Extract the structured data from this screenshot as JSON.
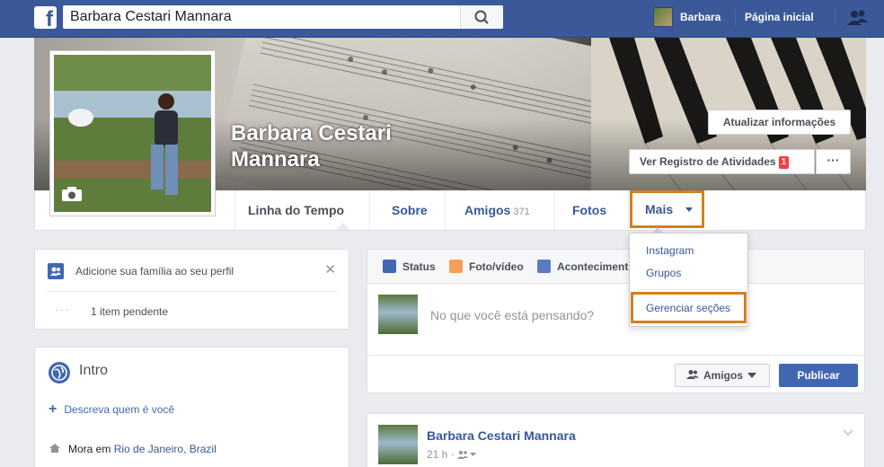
{
  "topbar": {
    "logo": "f",
    "search_value": "Barbara Cestari Mannara",
    "user_name": "Barbara",
    "home_label": "Página inicial"
  },
  "profile": {
    "name": "Barbara Cestari Mannara",
    "update_info": "Atualizar informações",
    "activity_log": "Ver Registro de Atividades",
    "activity_badge": "1",
    "more": "···"
  },
  "tabs": {
    "timeline": "Linha do Tempo",
    "about": "Sobre",
    "friends": "Amigos",
    "friends_count": "371",
    "photos": "Fotos",
    "more": "Mais"
  },
  "dropdown": {
    "items": [
      "Instagram",
      "Grupos"
    ],
    "manage": "Gerenciar seções"
  },
  "family": {
    "text": "Adicione sua família ao seu perfil",
    "close": "✕",
    "dots": "···",
    "pending": "1 item pendente"
  },
  "intro": {
    "title": "Intro",
    "add": "Descreva quem é você",
    "lives_prefix": "Mora em ",
    "lives_city": "Rio de Janeiro, Brazil"
  },
  "composer": {
    "tab_status": "Status",
    "tab_photo": "Foto/vídeo",
    "tab_event": "Acontecimento",
    "placeholder": "No que você está pensando?",
    "friends": "Amigos",
    "publish": "Publicar"
  },
  "post": {
    "author": "Barbara Cestari Mannara",
    "time": "21 h · "
  },
  "colors": {
    "brand": "#3b5998",
    "link": "#365899",
    "highlight": "#d47f1e",
    "button": "#4267b2"
  }
}
